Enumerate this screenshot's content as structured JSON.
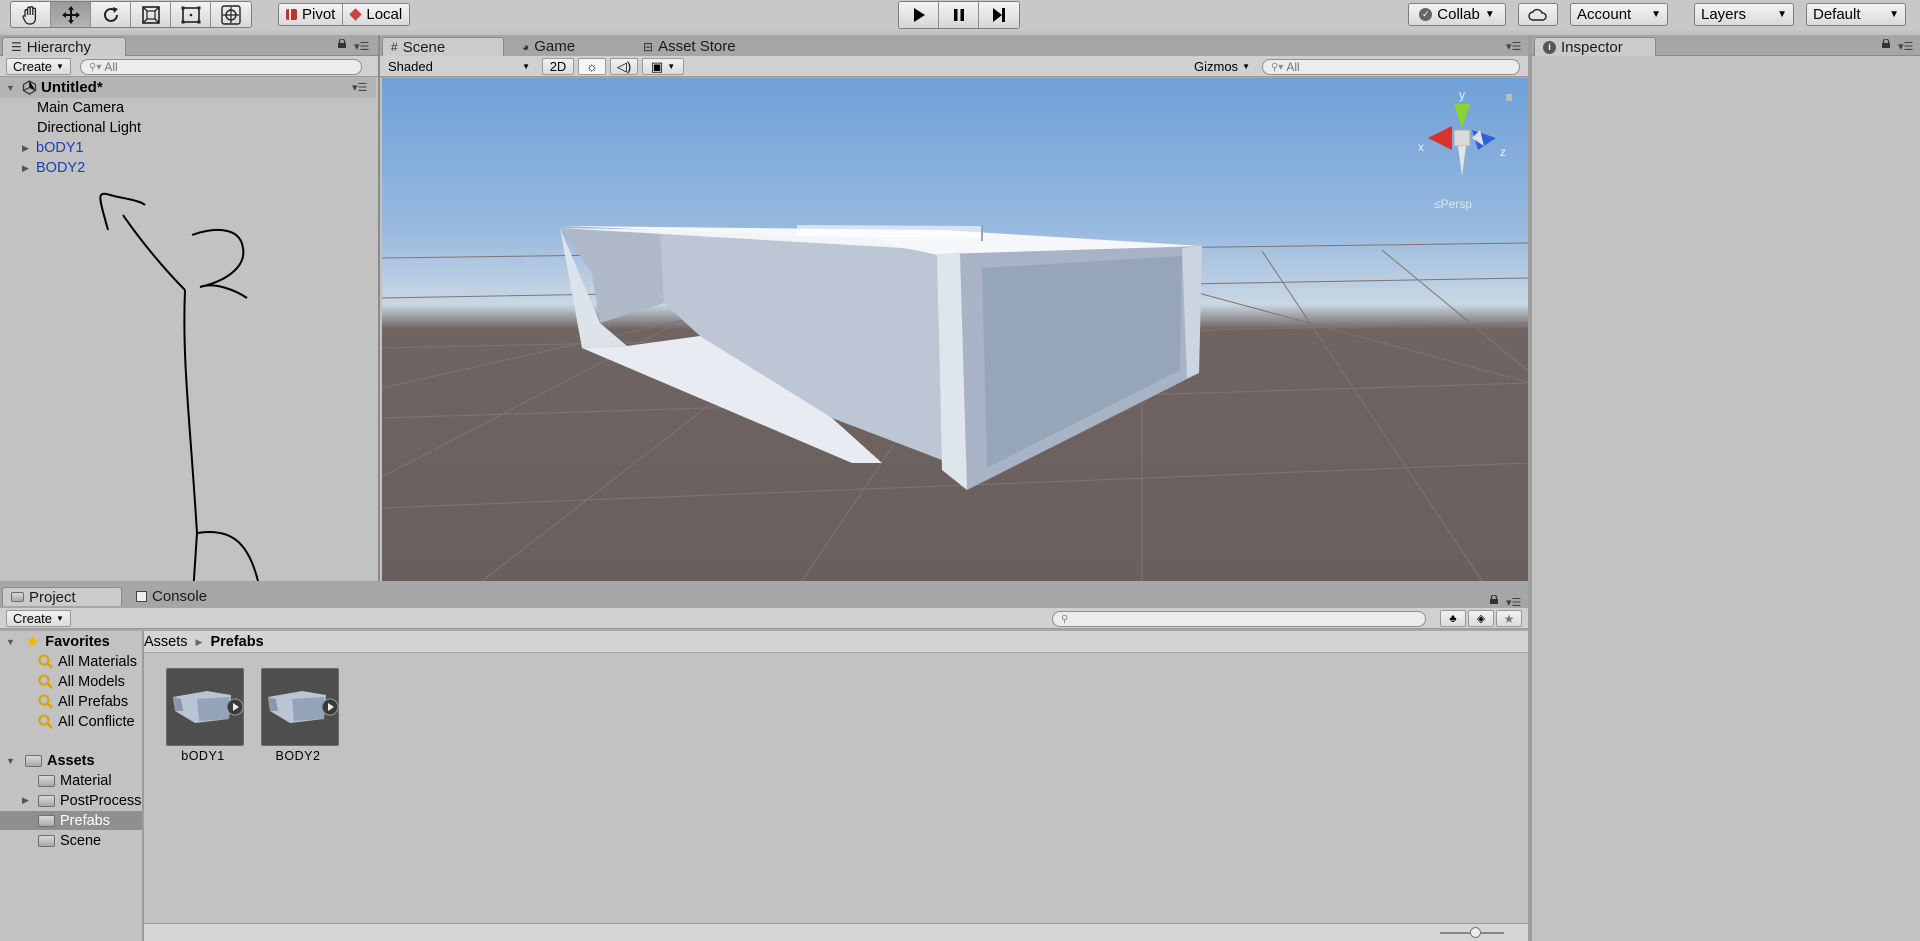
{
  "toolbar": {
    "tools": [
      "hand-tool",
      "move-tool",
      "rotate-tool",
      "scale-tool",
      "rect-tool",
      "transform-tool"
    ],
    "active_tool": "move-tool",
    "pivot_label": "Pivot",
    "local_label": "Local",
    "collab_label": "Collab",
    "account_label": "Account",
    "layers_label": "Layers",
    "layout_label": "Default"
  },
  "hierarchy": {
    "tab_label": "Hierarchy",
    "create_label": "Create",
    "search_placeholder": "All",
    "scene_name": "Untitled*",
    "items": [
      {
        "label": "Main Camera",
        "prefab": false,
        "expandable": false
      },
      {
        "label": "Directional Light",
        "prefab": false,
        "expandable": false
      },
      {
        "label": "bODY1",
        "prefab": true,
        "expandable": true
      },
      {
        "label": "BODY2",
        "prefab": true,
        "expandable": true
      }
    ]
  },
  "scene": {
    "tabs": [
      {
        "label": "Scene",
        "icon": "grid-icon"
      },
      {
        "label": "Game",
        "icon": "pacman-icon"
      },
      {
        "label": "Asset Store",
        "icon": "bag-icon"
      }
    ],
    "shading_mode": "Shaded",
    "mode_2d_label": "2D",
    "gizmos_label": "Gizmos",
    "search_placeholder": "All",
    "gizmo_axes": {
      "x": "x",
      "y": "y",
      "z": "z"
    },
    "projection_label": "Persp",
    "colors": {
      "x_axis": "#d8322a",
      "y_axis": "#8ed32a",
      "z_axis": "#2e5fd8"
    }
  },
  "inspector": {
    "tab_label": "Inspector"
  },
  "project": {
    "tabs": [
      "Project",
      "Console"
    ],
    "create_label": "Create",
    "favorites_label": "Favorites",
    "favorites": [
      "All Materials",
      "All Models",
      "All Prefabs",
      "All Conflicte"
    ],
    "assets_label": "Assets",
    "folders": [
      {
        "label": "Material",
        "expandable": false
      },
      {
        "label": "PostProcess",
        "expandable": true
      },
      {
        "label": "Prefabs",
        "expandable": false
      },
      {
        "label": "Scene",
        "expandable": false
      }
    ],
    "selected_folder": "Prefabs",
    "breadcrumb": [
      "Assets",
      "Prefabs"
    ],
    "assets": [
      "bODY1",
      "BODY2"
    ]
  }
}
